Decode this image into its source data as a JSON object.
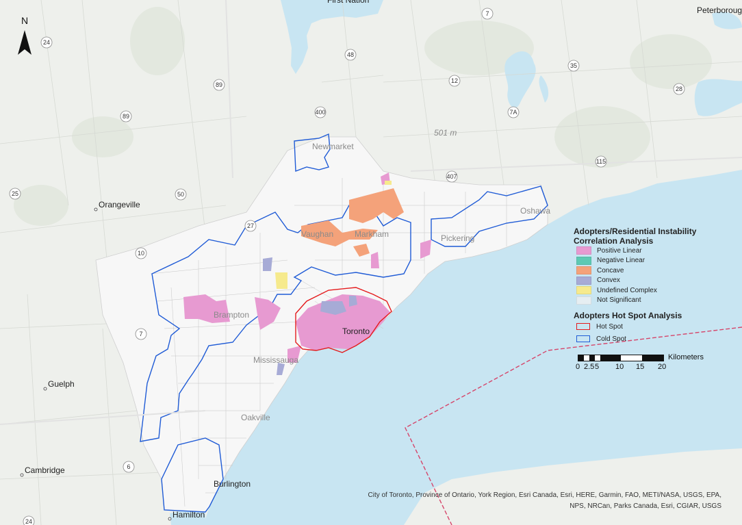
{
  "map": {
    "places_major": [
      {
        "name": "Guelph"
      },
      {
        "name": "Cambridge"
      },
      {
        "name": "Hamilton"
      },
      {
        "name": "Burlington"
      },
      {
        "name": "Toronto"
      },
      {
        "name": "Peterborough"
      }
    ],
    "places_minor": [
      {
        "name": "Orangeville"
      },
      {
        "name": "Newmarket"
      },
      {
        "name": "Vaughan"
      },
      {
        "name": "Markham"
      },
      {
        "name": "Brampton"
      },
      {
        "name": "Mississauga"
      },
      {
        "name": "Oakville"
      },
      {
        "name": "Pickering"
      },
      {
        "name": "Oshawa"
      },
      {
        "name": "First Nation"
      }
    ],
    "highways": [
      "24",
      "89",
      "89",
      "25",
      "10",
      "50",
      "27",
      "400",
      "48",
      "12",
      "7",
      "7A",
      "35",
      "28",
      "115",
      "407",
      "7",
      "6",
      "24"
    ],
    "elevation_label": "501 m",
    "north_label": "N",
    "colors": {
      "water": "#c8e5f2",
      "land": "#eef0ec",
      "study_area": "#f7f7f7",
      "boundary": "#c5c5c5",
      "hot_spot": "#e41a1c",
      "cold_spot": "#1f5bd6",
      "border_line": "#d6456a"
    }
  },
  "legend": {
    "title": "Adopters/Residential Instability Correlation Analysis",
    "items": [
      {
        "label": "Positive Linear",
        "color": "#e79ad1"
      },
      {
        "label": "Negative Linear",
        "color": "#5ec9b3"
      },
      {
        "label": "Concave",
        "color": "#f4a27a"
      },
      {
        "label": "Convex",
        "color": "#a7abd6"
      },
      {
        "label": "Undefined Complex",
        "color": "#f6ea8d"
      },
      {
        "label": "Not Significant",
        "color": "#e6eef2"
      }
    ],
    "hotspot_title": "Adopters Hot Spot Analysis",
    "hotspot_items": [
      {
        "label": "Hot Spot",
        "color": "#e41a1c"
      },
      {
        "label": "Cold Spot",
        "color": "#1f5bd6"
      }
    ]
  },
  "scalebar": {
    "units": "Kilometers",
    "ticks": [
      "0",
      "2.5",
      "5",
      "10",
      "15",
      "20"
    ]
  },
  "credits": {
    "line1": "City of Toronto, Province of Ontario, York Region, Esri Canada, Esri, HERE, Garmin, FAO, METI/NASA, USGS, EPA,",
    "line2": "NPS, NRCan, Parks Canada, Esri, CGIAR, USGS"
  }
}
